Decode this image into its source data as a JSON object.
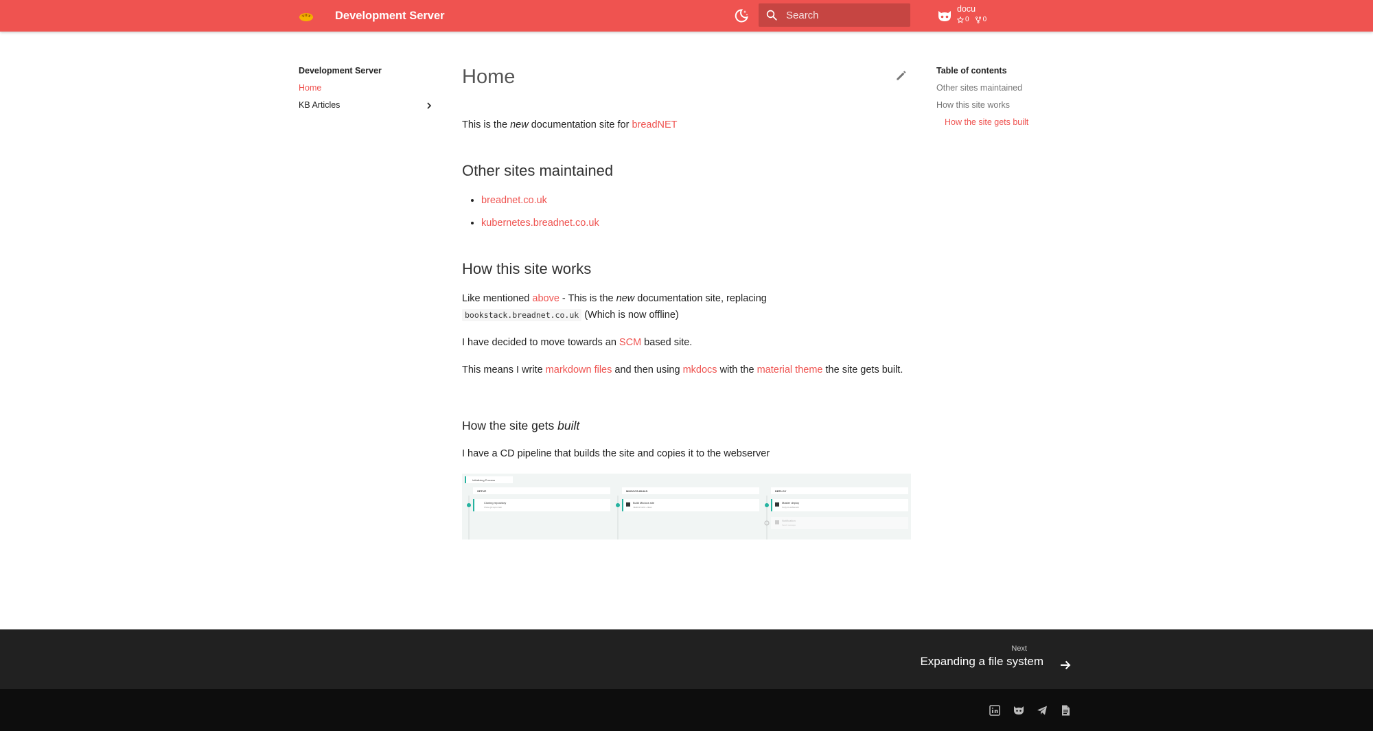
{
  "header": {
    "title": "Development Server",
    "search_placeholder": "Search",
    "repo": {
      "name": "docu",
      "stars": "0",
      "forks": "0"
    }
  },
  "nav": {
    "title": "Development Server",
    "items": [
      {
        "label": "Home",
        "active": true
      },
      {
        "label": "KB Articles",
        "expandable": true
      }
    ]
  },
  "content": {
    "title": "Home",
    "intro": {
      "pre": "This is the ",
      "em": "new",
      "mid": " documentation site for ",
      "link": "breadNET"
    },
    "h_other": "Other sites maintained",
    "sites": [
      "breadnet.co.uk",
      "kubernetes.breadnet.co.uk"
    ],
    "h_how": "How this site works",
    "p1": {
      "pre": "Like mentioned ",
      "link": "above",
      "mid1": " - This is the ",
      "em": "new",
      "mid2": " documentation site, replacing",
      "code": "bookstack.breadnet.co.uk",
      "post": " (Which is now offline)"
    },
    "p2": {
      "pre": "I have decided to move towards an ",
      "link": "SCM",
      "post": " based site."
    },
    "p3": {
      "pre": "This means I write ",
      "link1": "markdown files",
      "mid1": " and then using ",
      "link2": "mkdocs",
      "mid2": " with the ",
      "link3": "material theme",
      "post": " the site gets built."
    },
    "h_built": {
      "pre": "How the site gets ",
      "em": "built"
    },
    "p4": "I have a CD pipeline that builds the site and copies it to the webserver",
    "pipeline": {
      "header": "Initializing Process",
      "stages": [
        {
          "name": "SETUP",
          "job": "Cloning repository",
          "sub": "Clone git repo main"
        },
        {
          "name": "MKDOCS-BUILD",
          "job": "Build Mkdocs site",
          "sub": "mkdocs build --clean"
        },
        {
          "name": "DEPLOY",
          "job": "Master deploy",
          "sub": "Copy to webserver",
          "job2": "Notification",
          "sub2": "Send message"
        }
      ]
    }
  },
  "toc": {
    "title": "Table of contents",
    "items": [
      {
        "label": "Other sites maintained"
      },
      {
        "label": "How this site works"
      },
      {
        "label": "How the site gets built",
        "sub": true,
        "active": true
      }
    ]
  },
  "footer": {
    "next_label": "Next",
    "next_title": "Expanding a file system"
  },
  "colors": {
    "primary": "#ef5350",
    "footer": "#212121",
    "footer_meta": "#0d0d0d",
    "accent_teal": "#26b3a0"
  },
  "icons": [
    "bread-logo-icon",
    "moon-icon",
    "search-icon",
    "github-icon",
    "star-icon",
    "fork-icon",
    "chevron-right-icon",
    "pencil-icon",
    "arrow-right-icon",
    "linkedin-icon",
    "github-icon",
    "telegram-icon",
    "document-icon"
  ]
}
